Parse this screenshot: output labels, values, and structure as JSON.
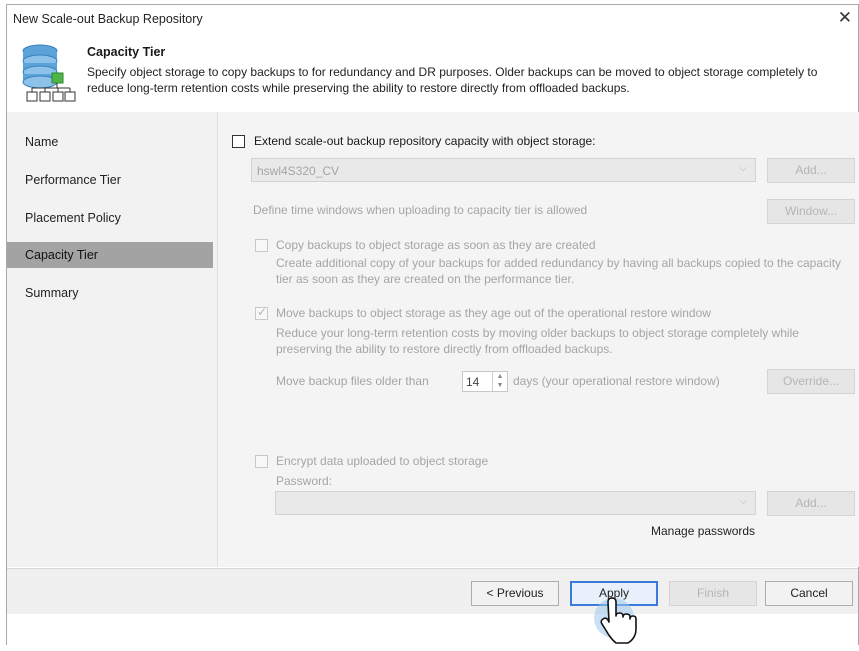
{
  "window": {
    "title": "New Scale-out Backup Repository",
    "close_glyph": "✕"
  },
  "header": {
    "icon": "repository-database-icon",
    "title": "Capacity Tier",
    "description": "Specify object storage to copy backups to for redundancy and DR purposes. Older backups can be moved to object storage completely to reduce long-term retention costs while preserving the ability to restore directly from offloaded backups."
  },
  "sidebar": {
    "items": [
      {
        "label": "Name"
      },
      {
        "label": "Performance Tier"
      },
      {
        "label": "Placement Policy"
      },
      {
        "label": "Capacity Tier",
        "active": true
      },
      {
        "label": "Summary"
      }
    ]
  },
  "content": {
    "extend": {
      "label": "Extend scale-out backup repository capacity with object storage:",
      "checked": false
    },
    "repository": {
      "value": "hswl4S320_CV",
      "add_button": "Add..."
    },
    "time_window": {
      "label": "Define time windows when uploading to capacity tier is allowed",
      "button": "Window..."
    },
    "copy": {
      "label": "Copy backups to object storage as soon as they are created",
      "checked": false,
      "description": "Create additional copy of your backups for added redundancy by having all backups copied to the capacity tier as soon as they are created on the performance tier."
    },
    "move": {
      "label": "Move backups to object storage as they age out of the operational restore window",
      "checked": true,
      "description": "Reduce your long-term retention costs by moving older backups to object storage completely while preserving the ability to restore directly from offloaded backups.",
      "older_than_prefix": "Move backup files older than",
      "days_value": "14",
      "older_than_suffix": "days (your operational restore window)",
      "override_button": "Override..."
    },
    "encrypt": {
      "label": "Encrypt data uploaded to object storage",
      "checked": false,
      "password_label": "Password:",
      "password_value": "",
      "add_button": "Add...",
      "manage_link": "Manage passwords"
    }
  },
  "footer": {
    "previous": "< Previous",
    "apply": "Apply",
    "finish": "Finish",
    "cancel": "Cancel"
  },
  "colors": {
    "active_nav": "#a3a3a3",
    "focus_border": "#3b7ad8",
    "disabled_text": "#a5a5a5"
  }
}
